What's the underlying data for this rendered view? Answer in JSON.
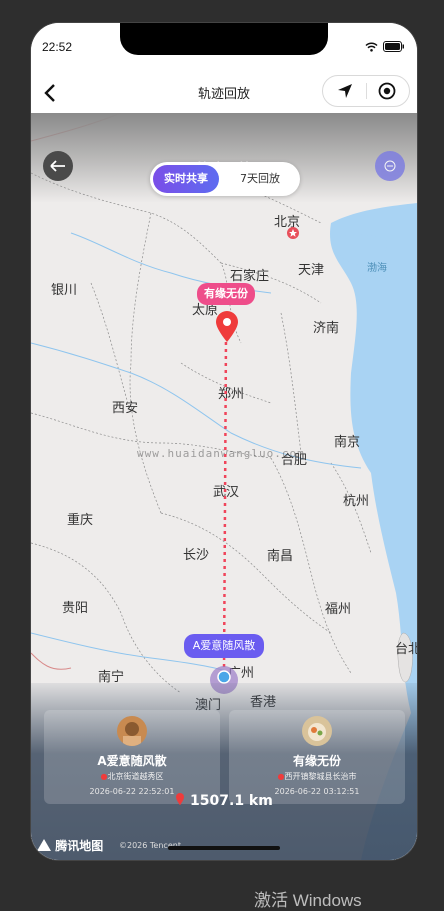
{
  "status_bar": {
    "time": "22:52"
  },
  "nav": {
    "title": "轨迹回放"
  },
  "map": {
    "title": "轨迹回放",
    "tabs": [
      {
        "label": "实时共享",
        "active": true
      },
      {
        "label": "7天回放",
        "active": false
      }
    ],
    "cities": [
      "北京",
      "天津",
      "石家庄",
      "银川",
      "太原",
      "济南",
      "西安",
      "郑州",
      "南京",
      "合肥",
      "武汉",
      "杭州",
      "重庆",
      "长沙",
      "南昌",
      "贵阳",
      "福州",
      "南宁",
      "广州",
      "台北",
      "澳门",
      "香港"
    ],
    "sea_label": "渤海",
    "watermark": "www.huaidanwangluo.com",
    "start_bubble": "有缘无份",
    "end_bubble": "A爱意随风散",
    "accent_color": "#6a5cf0",
    "route_color": "#f0445a",
    "logo": "腾讯地图",
    "copyright": "©2026 Tencent"
  },
  "cards": [
    {
      "name": "A爱意随风散",
      "location": "北京街道越秀区",
      "time": "2026-06-22 22:52:01"
    },
    {
      "name": "有缘无份",
      "location": "西开镇黎城县长治市",
      "time": "2026-06-22 03:12:51"
    }
  ],
  "distance": "1507.1 km",
  "os_overlay": "激活 Windows"
}
